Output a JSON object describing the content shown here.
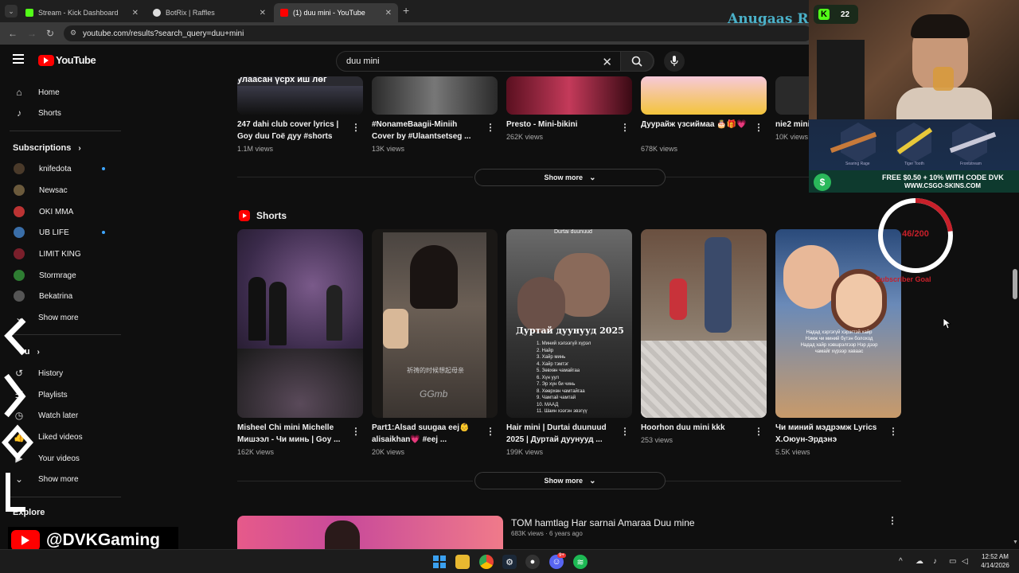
{
  "browser": {
    "tabs": [
      {
        "label": "Stream - Kick Dashboard"
      },
      {
        "label": "BotRix | Raffles"
      },
      {
        "label": "(1) duu mini - YouTube"
      }
    ],
    "new_tab": "+",
    "url": "youtube.com/results?search_query=duu+mini"
  },
  "youtube": {
    "logo_text": "YouTube",
    "search_value": "duu mini"
  },
  "sidebar": {
    "main": [
      {
        "label": "Home"
      },
      {
        "label": "Shorts"
      }
    ],
    "subscriptions_title": "Subscriptions",
    "subscriptions": [
      {
        "label": "knifedota",
        "color": "#4a3a2a"
      },
      {
        "label": "Newsac",
        "color": "#6b5a3c"
      },
      {
        "label": "OKI MMA",
        "color": "#b33"
      },
      {
        "label": "UB LIFE",
        "color": "#3a6ea8"
      },
      {
        "label": "LIMIT KING",
        "color": "#7a1f2b"
      },
      {
        "label": "Stormrage",
        "color": "#2e7d32"
      },
      {
        "label": "Bekatrina",
        "color": "#555"
      }
    ],
    "show_more_1": "Show more",
    "you_title": "ou",
    "you_items": [
      {
        "label": "History"
      },
      {
        "label": "Playlists"
      },
      {
        "label": "Watch later"
      },
      {
        "label": "Liked videos"
      },
      {
        "label": "Your videos"
      },
      {
        "label": "Show more"
      }
    ],
    "explore_title": "Explore"
  },
  "top_videos": [
    {
      "title": "247 dahi club cover lyrics | Goy duu Гоё дуу #shorts",
      "views": "1.1M views"
    },
    {
      "title": "#NonameBaagii-Miniih Cover by #Ulaantsetseg ...",
      "views": "13K views"
    },
    {
      "title": "Presto - Mini-bikini",
      "views": "262K views"
    },
    {
      "title": "Дуурайж үзсиймаа 🎂🎁💗",
      "views": "678K views"
    },
    {
      "title": "nie2 mini",
      "views": "10K views"
    }
  ],
  "partial_caption": "улаасан үсрх иш лөг",
  "show_more_top": "Show more",
  "shorts_title": "Shorts",
  "shorts": [
    {
      "title": "Misheel Chi mini Michelle Мишээл - Чи минь | Goy ...",
      "views": "162K views"
    },
    {
      "title": "Part1:Alsad suugaa eej👶 alisaikhan💗 #eej ...",
      "views": "20K views"
    },
    {
      "title": "Hair mini | Durtai duunuud 2025 | Дуртай дуунууд ...",
      "views": "199K views"
    },
    {
      "title": "Hoorhon duu mini kkk",
      "views": "253 views"
    },
    {
      "title": "Чи миний мэдрэмж Lyrics Х.Оюун-Эрдэнэ",
      "views": "5.5K views"
    }
  ],
  "shorts_overlay": {
    "thumb2_caption": "GGmb",
    "thumb2_sub": "祈祷的时候想起母亲",
    "thumb3_logo": "Durtai duunuud",
    "thumb3_title": "Дуртай дуунууд 2025",
    "thumb3_list": [
      "1. Миний хэлээгүй хүрэл",
      "2. Найр",
      "3. Хайр минь",
      "4. Хайр тэмтэг",
      "5. Зөвхөн чамайгаа",
      "6. Хүн уул",
      "7. Эр хүн би чинь",
      "8. Хөөрхөн чамтайгаа",
      "9. Чамтай чамтай",
      "10. МААД",
      "11. Шаин хээгэн эвэгүү"
    ],
    "thumb5_text": "Надад хэргэгүй хэрэгтэй хайр Нэмж чи миний бүтэн болоход Надад хайр хэвшрэлгээр Нэр дээр чамайг хүрээр хаваас"
  },
  "show_more_shorts": "Show more",
  "result": {
    "title": "TOM hamtlag Har sarnai Amaraa Duu mine",
    "meta": "683K views · 6 years ago"
  },
  "stream": {
    "overlay_brand": "Anugaas Re",
    "kick_count": "22",
    "banner_items": [
      "Searing Rage",
      "Tiger Tooth",
      "Frontstream"
    ],
    "banner_promo": "FREE $0.50 + 10% WITH CODE DVK",
    "banner_url": "WWW.CSGO-SKINS.COM",
    "goal_value": "46/200",
    "goal_label": "Subscriber Goal",
    "goal_fraction": 0.23,
    "handle": "@DVKGaming"
  },
  "taskbar": {
    "time": "12:52 AM",
    "date": "4/14/2026",
    "discord_badge": "9+"
  },
  "colors": {
    "youtube_red": "#ff0000",
    "kick_green": "#53fc18",
    "link_blue": "#3ea6ff"
  }
}
